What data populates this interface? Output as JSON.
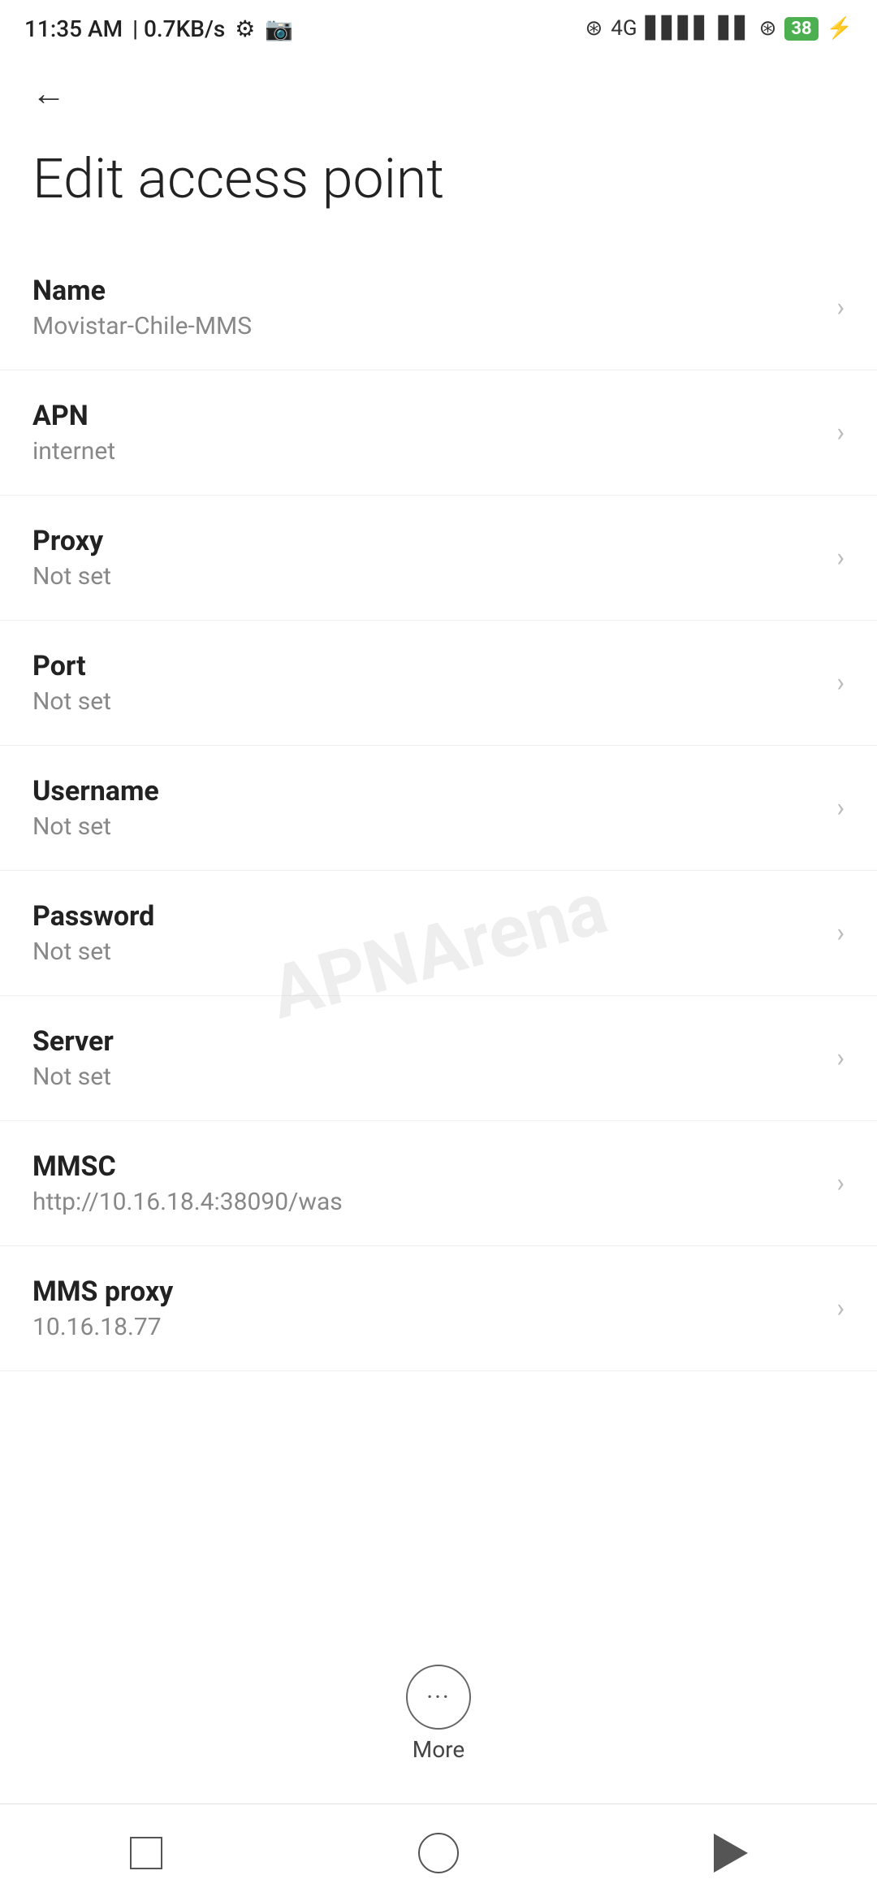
{
  "statusBar": {
    "time": "11:35 AM",
    "speed": "0.7KB/s",
    "battery": "38",
    "batterySymbol": "⚡"
  },
  "header": {
    "backLabel": "←",
    "title": "Edit access point"
  },
  "settings": [
    {
      "label": "Name",
      "value": "Movistar-Chile-MMS"
    },
    {
      "label": "APN",
      "value": "internet"
    },
    {
      "label": "Proxy",
      "value": "Not set"
    },
    {
      "label": "Port",
      "value": "Not set"
    },
    {
      "label": "Username",
      "value": "Not set"
    },
    {
      "label": "Password",
      "value": "Not set"
    },
    {
      "label": "Server",
      "value": "Not set"
    },
    {
      "label": "MMSC",
      "value": "http://10.16.18.4:38090/was"
    },
    {
      "label": "MMS proxy",
      "value": "10.16.18.77"
    }
  ],
  "moreButton": {
    "label": "More"
  },
  "watermark": "APNArena"
}
